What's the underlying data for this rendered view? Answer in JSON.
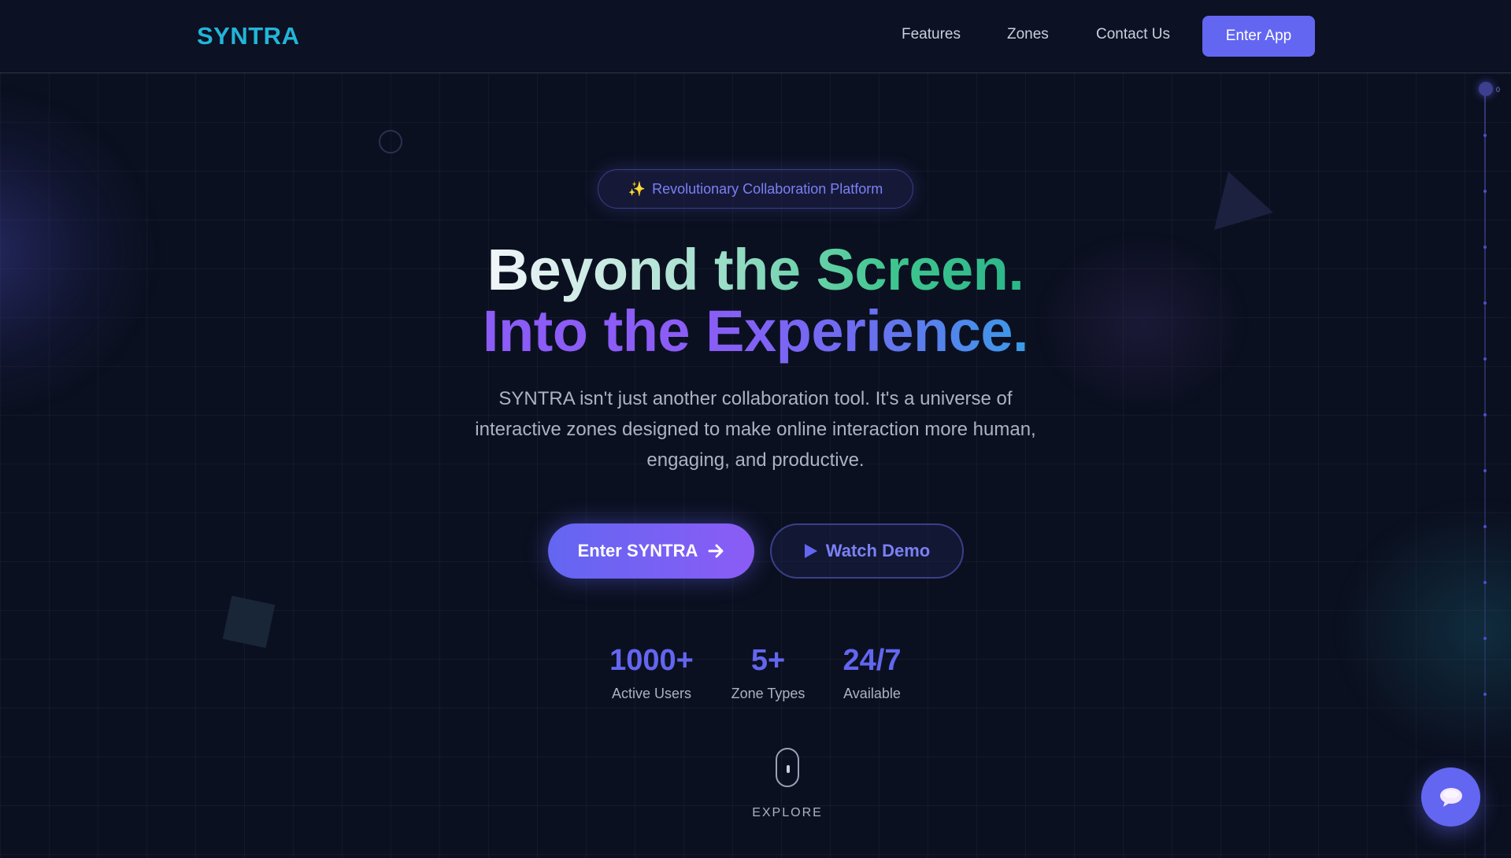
{
  "header": {
    "logo": "SYNTRA",
    "nav": {
      "features": "Features",
      "zones": "Zones",
      "contact": "Contact Us"
    },
    "cta": "Enter App"
  },
  "hero": {
    "badge_icon": "sparkles-icon",
    "badge_text": "Revolutionary Collaboration Platform",
    "headline_line1": "Beyond the Screen.",
    "headline_line2": "Into the Experience.",
    "subtitle": "SYNTRA isn't just another collaboration tool. It's a universe of interactive zones designed to make online interaction more human, engaging, and productive.",
    "primary_button": "Enter SYNTRA",
    "secondary_button": "Watch Demo"
  },
  "stats": [
    {
      "value": "1000+",
      "label": "Active Users"
    },
    {
      "value": "5+",
      "label": "Zone Types"
    },
    {
      "value": "24/7",
      "label": "Available"
    }
  ],
  "scroll_indicator": {
    "label": "EXPLORE"
  },
  "timeline": {
    "label": "0"
  },
  "colors": {
    "background": "#0b1020",
    "accent": "#6366f1",
    "accent_purple": "#8b5cf6",
    "logo": "#22b5d8",
    "headline_green": "#3fc68f"
  }
}
